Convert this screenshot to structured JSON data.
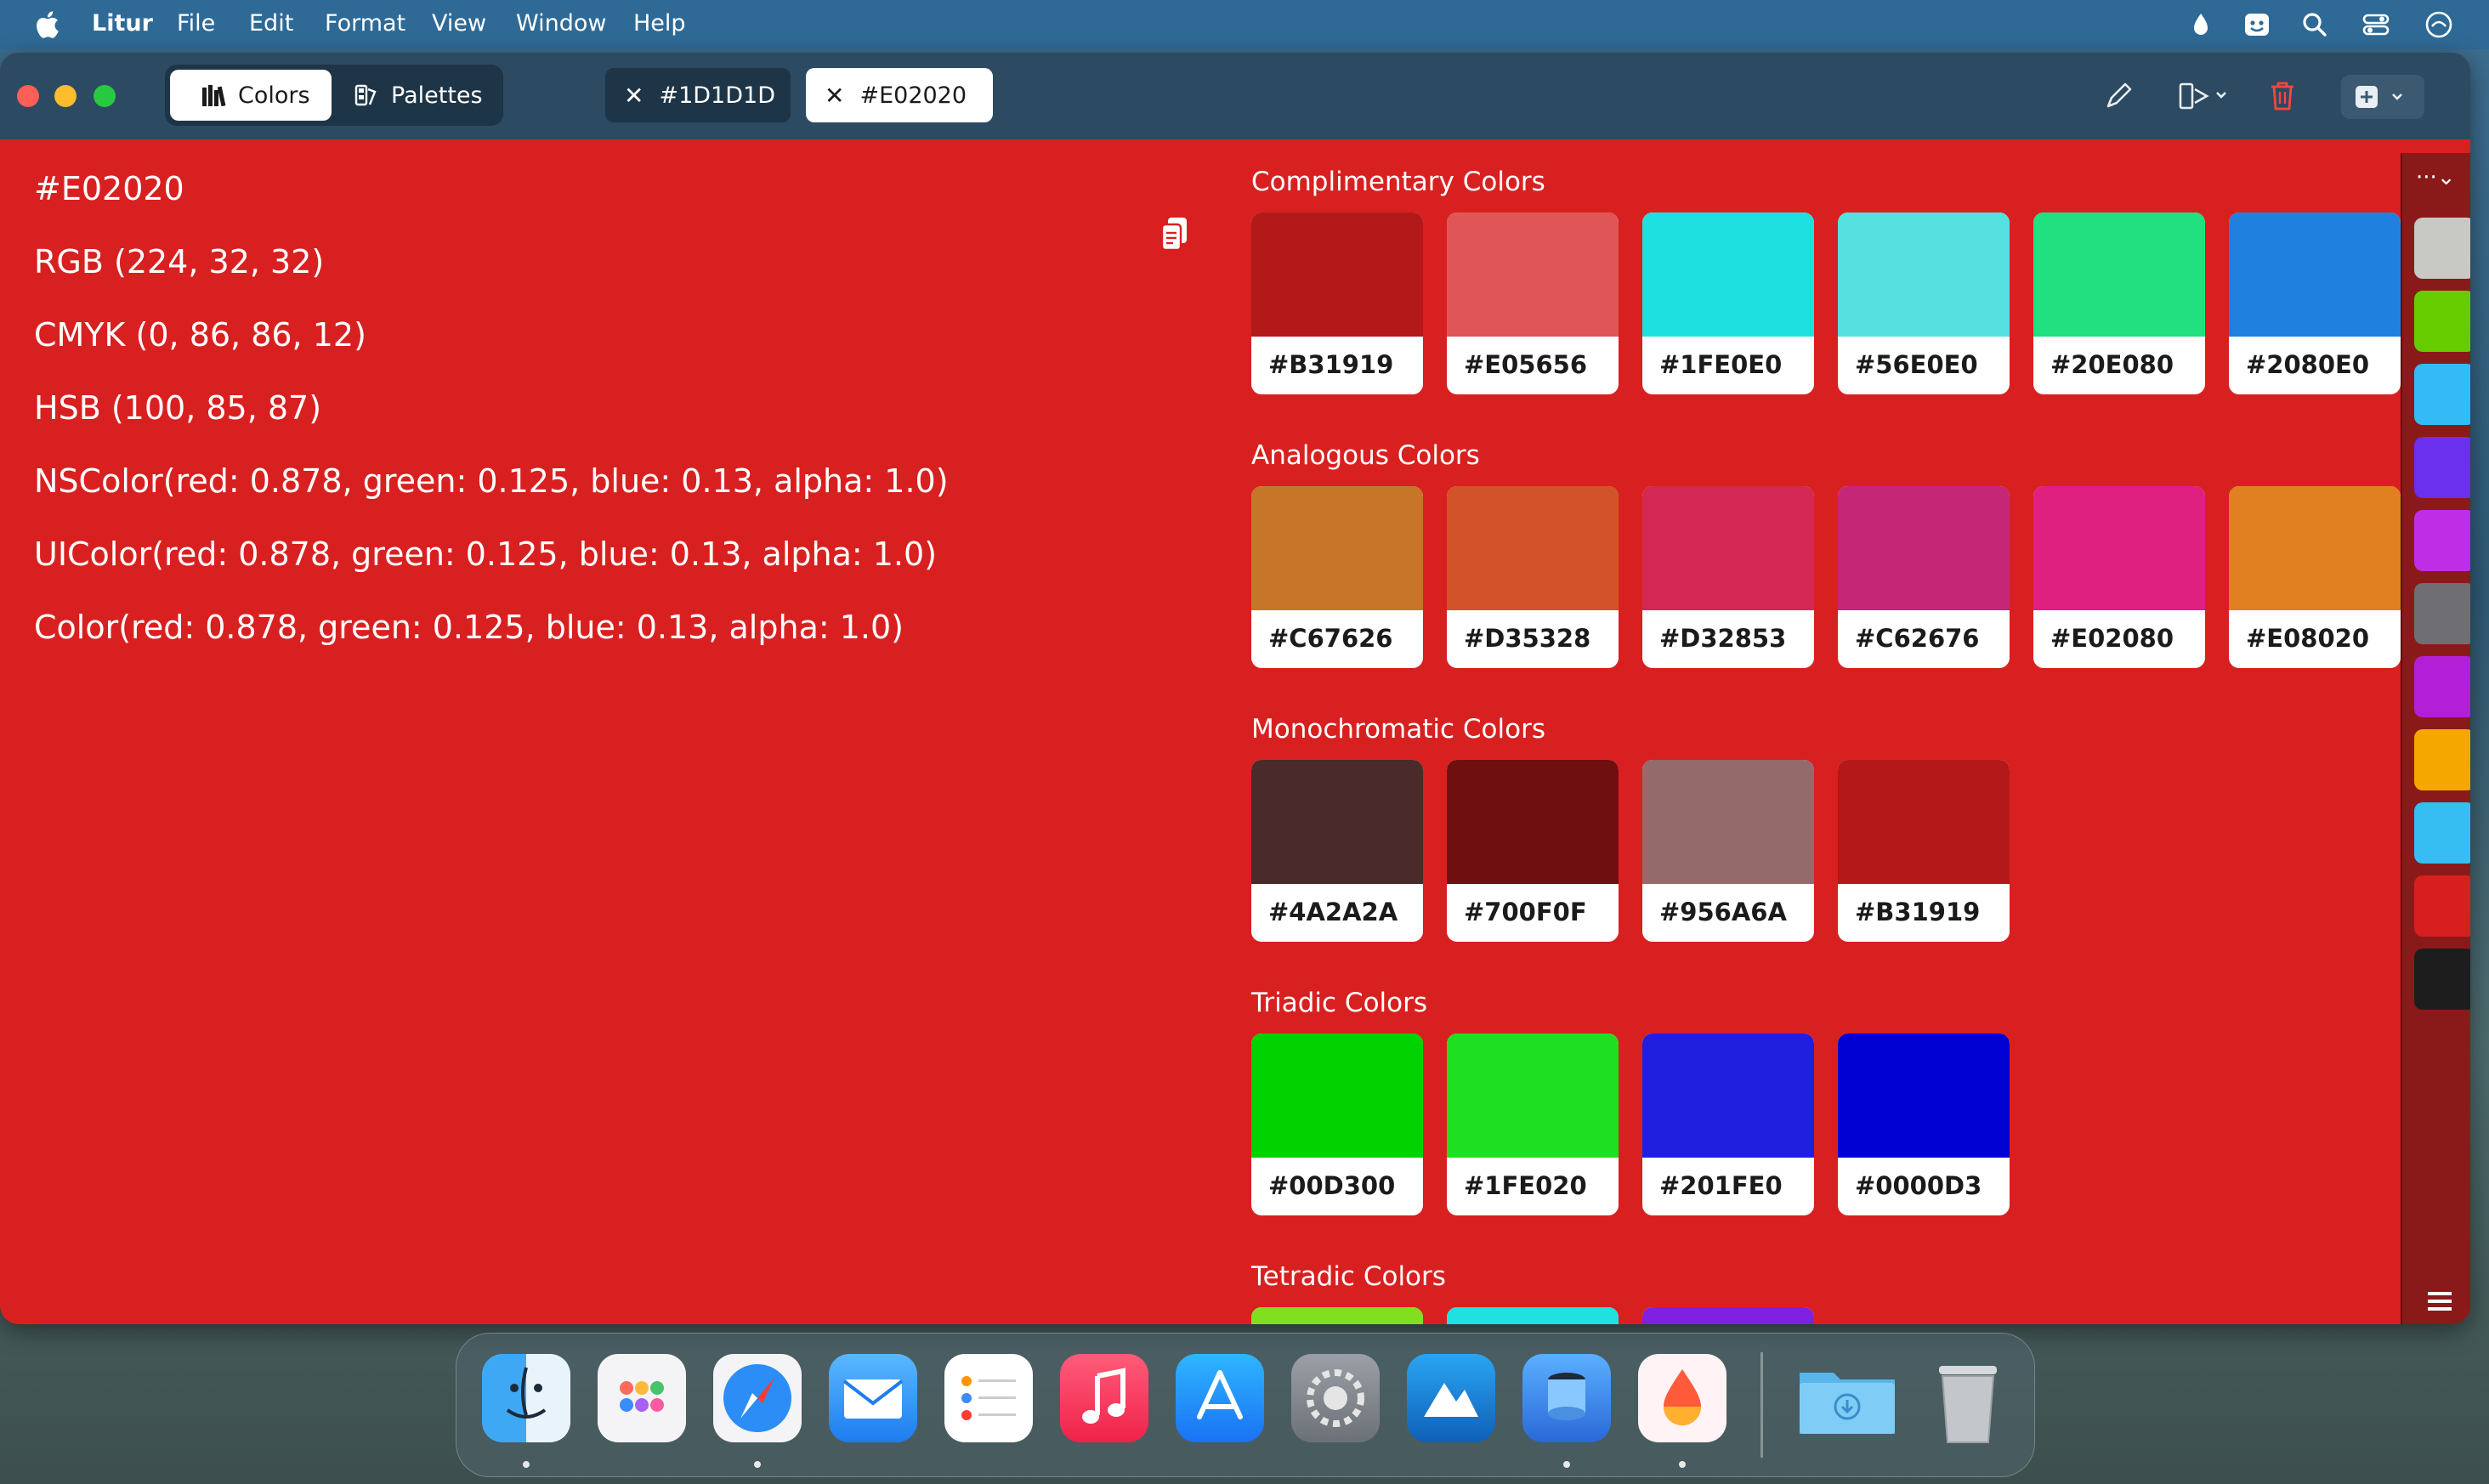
{
  "menubar": {
    "app_name": "Litur",
    "items": [
      "File",
      "Edit",
      "Format",
      "View",
      "Window",
      "Help"
    ],
    "right_icons": [
      "drop-icon",
      "app-face-icon",
      "search-icon",
      "control-center-icon",
      "siri-icon"
    ]
  },
  "toolbar": {
    "segments": [
      {
        "label": "Colors",
        "icon": "library-icon",
        "active": true
      },
      {
        "label": "Palettes",
        "icon": "palettes-icon",
        "active": false
      }
    ],
    "tabs": [
      {
        "label": "#1D1D1D",
        "active": false
      },
      {
        "label": "#E02020",
        "active": true
      }
    ],
    "tools": [
      "pencil-icon",
      "export-menu-icon",
      "trash-icon",
      "add-menu-icon"
    ]
  },
  "color_info": {
    "hex": "#E02020",
    "rgb": "RGB (224, 32, 32)",
    "cmyk": "CMYK (0, 86, 86, 12)",
    "hsb": "HSB (100, 85, 87)",
    "nscolor": "NSColor(red: 0.878, green: 0.125, blue: 0.13, alpha: 1.0)",
    "uicolor": "UIColor(red: 0.878, green: 0.125, blue: 0.13, alpha: 1.0)",
    "swiftui_color": "Color(red: 0.878, green: 0.125, blue: 0.13, alpha: 1.0)"
  },
  "sections": [
    {
      "title": "Complimentary Colors",
      "colors": [
        "#B31919",
        "#E05656",
        "#1FE0E0",
        "#56E0E0",
        "#20E080",
        "#2080E0"
      ]
    },
    {
      "title": "Analogous Colors",
      "colors": [
        "#C67626",
        "#D35328",
        "#D32853",
        "#C62676",
        "#E02080",
        "#E08020"
      ]
    },
    {
      "title": "Monochromatic Colors",
      "colors": [
        "#4A2A2A",
        "#700F0F",
        "#956A6A",
        "#B31919"
      ]
    },
    {
      "title": "Triadic Colors",
      "colors": [
        "#00D300",
        "#1FE020",
        "#201FE0",
        "#0000D3"
      ]
    },
    {
      "title": "Tetradic Colors",
      "colors": [
        "#80E020",
        "#20E0E0",
        "#8020E0"
      ]
    }
  ],
  "palette_rail": {
    "more_label": "···⌄",
    "colors": [
      "#C8C8C4",
      "#66CC00",
      "#33BBF5",
      "#6A30EE",
      "#BF2EE6",
      "#6F6F73",
      "#B21FD6",
      "#F5A700",
      "#36BDF2",
      "#D81F1F",
      "#1D1D1D"
    ]
  },
  "dock": {
    "apps": [
      "Finder",
      "Launchpad",
      "Safari",
      "Mail",
      "Reminders",
      "Music",
      "App Store",
      "System Settings",
      "Instruments",
      "Preview",
      "Litur",
      "Downloads",
      "Trash"
    ]
  }
}
